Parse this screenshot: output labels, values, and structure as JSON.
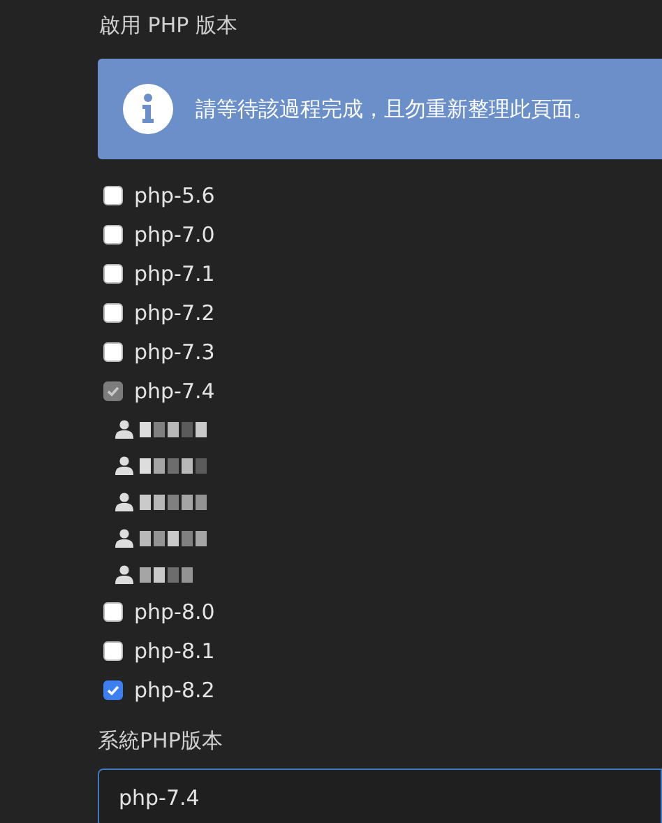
{
  "heading": "啟用 PHP 版本",
  "alert": {
    "text": "請等待該過程完成，且勿重新整理此頁面。"
  },
  "php_versions": [
    {
      "label": "php-5.6",
      "checked": false,
      "disabled": false
    },
    {
      "label": "php-7.0",
      "checked": false,
      "disabled": false
    },
    {
      "label": "php-7.1",
      "checked": false,
      "disabled": false
    },
    {
      "label": "php-7.2",
      "checked": false,
      "disabled": false
    },
    {
      "label": "php-7.3",
      "checked": false,
      "disabled": false
    },
    {
      "label": "php-7.4",
      "checked": true,
      "disabled": true,
      "users": [
        {
          "kind": "redacted"
        },
        {
          "kind": "redacted"
        },
        {
          "kind": "redacted"
        },
        {
          "kind": "redacted"
        },
        {
          "kind": "redacted"
        }
      ]
    },
    {
      "label": "php-8.0",
      "checked": false,
      "disabled": false
    },
    {
      "label": "php-8.1",
      "checked": false,
      "disabled": false
    },
    {
      "label": "php-8.2",
      "checked": true,
      "disabled": false
    }
  ],
  "system_php": {
    "label": "系統PHP版本",
    "value": "php-7.4"
  }
}
